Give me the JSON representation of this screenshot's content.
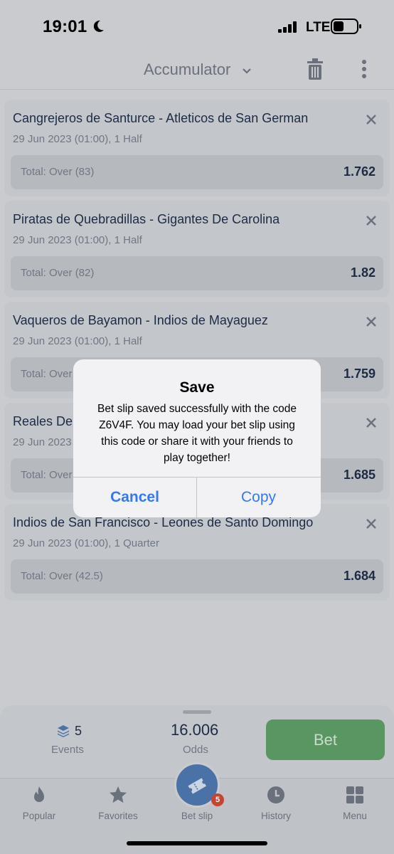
{
  "status_bar": {
    "time": "19:01",
    "network": "LTE"
  },
  "header": {
    "title": "Accumulator"
  },
  "bets": [
    {
      "match": "Cangrejeros de Santurce - Atleticos de San German",
      "date": "29 Jun 2023 (01:00), 1 Half",
      "market": "Total: Over (83)",
      "odd": "1.762"
    },
    {
      "match": "Piratas de Quebradillas - Gigantes De Carolina",
      "date": "29 Jun 2023 (01:00), 1 Half",
      "market": "Total: Over (82)",
      "odd": "1.82"
    },
    {
      "match": "Vaqueros de Bayamon - Indios de Mayaguez",
      "date": "29 Jun 2023 (01:00), 1 Half",
      "market": "Total: Over",
      "odd": "1.759"
    },
    {
      "match": "Reales De",
      "date": "29 Jun 2023",
      "market": "Total: Over",
      "odd": "1.685"
    },
    {
      "match": "Indios de San Francisco - Leones de Santo Domingo",
      "date": "29 Jun 2023 (01:00), 1 Quarter",
      "market": "Total: Over (42.5)",
      "odd": "1.684"
    }
  ],
  "dialog": {
    "title": "Save",
    "message": "Bet slip saved successfully with the code Z6V4F. You may load your bet slip using this code or share it with your friends to play together!",
    "cancel": "Cancel",
    "copy": "Copy"
  },
  "summary": {
    "events_count": "5",
    "events_label": "Events",
    "odds_value": "16.006",
    "odds_label": "Odds",
    "bet_button": "Bet"
  },
  "tabbar": {
    "popular": "Popular",
    "favorites": "Favorites",
    "betslip": "Bet slip",
    "betslip_badge": "5",
    "history": "History",
    "menu": "Menu"
  },
  "colors": {
    "bet_button": "#5a9662",
    "dialog_button": "#3478f6",
    "badge": "#c84432",
    "betslip_tab": "#4b72a6"
  }
}
